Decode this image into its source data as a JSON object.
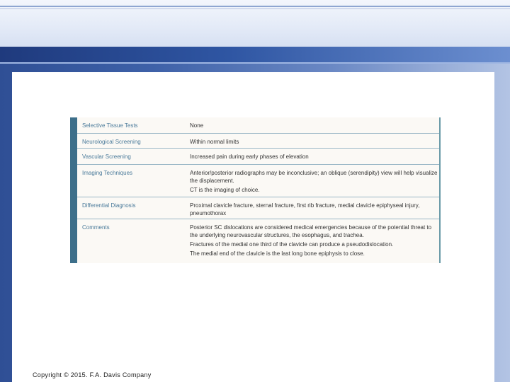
{
  "table": {
    "rows": [
      {
        "label": "Selective Tissue Tests",
        "values": [
          "None"
        ]
      },
      {
        "label": "Neurological Screening",
        "values": [
          "Within normal limits"
        ]
      },
      {
        "label": "Vascular Screening",
        "values": [
          "Increased pain during early phases of elevation"
        ]
      },
      {
        "label": "Imaging Techniques",
        "values": [
          "Anterior/posterior radiographs may be inconclusive; an oblique (serendipity) view will help visualize the displacement.",
          "CT is the imaging of choice."
        ]
      },
      {
        "label": "Differential Diagnosis",
        "values": [
          "Proximal clavicle fracture, sternal fracture, first rib fracture, medial clavicle epiphyseal injury, pneumothorax"
        ]
      },
      {
        "label": "Comments",
        "values": [
          "Posterior SC dislocations are considered medical emergencies because of the potential threat to the underlying neurovascular structures, the esophagus, and trachea.",
          "Fractures of the medial one third of the clavicle can produce a pseudodislocation.",
          "The medial end of the clavicle is the last long bone epiphysis to close."
        ]
      }
    ]
  },
  "footer": {
    "copyright": "Copyright © 2015. F.A. Davis Company"
  }
}
